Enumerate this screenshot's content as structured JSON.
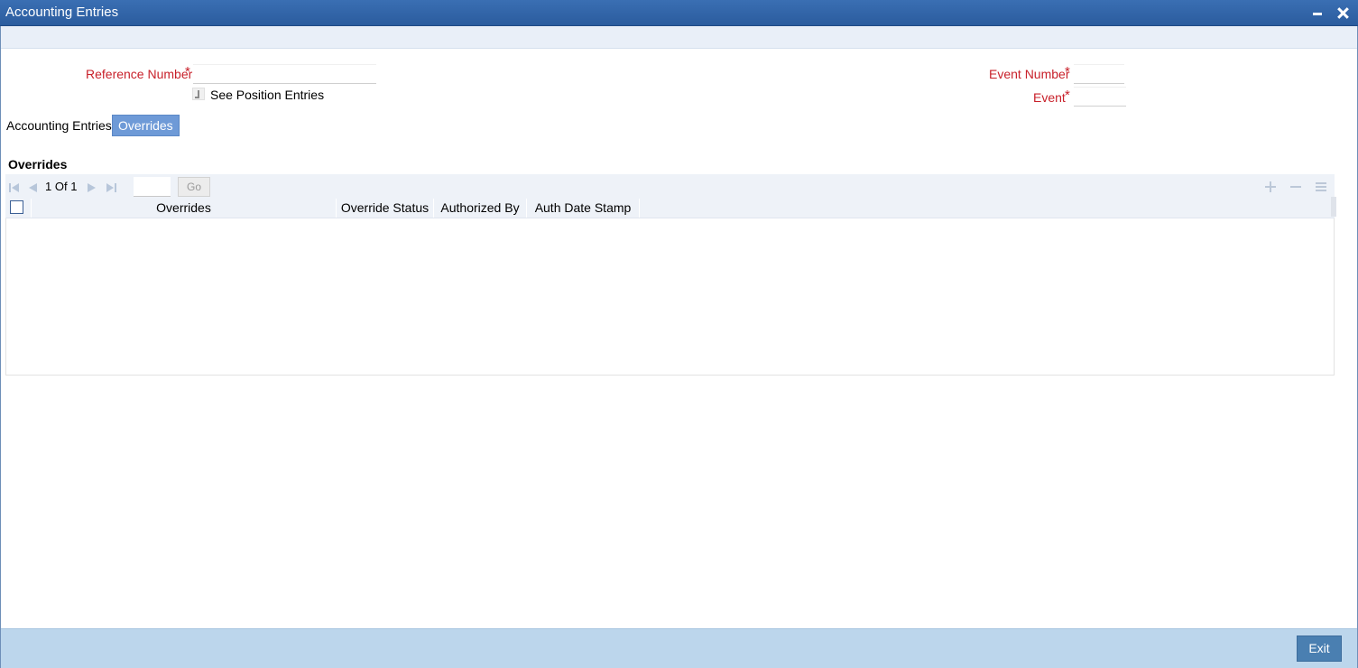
{
  "window": {
    "title": "Accounting Entries"
  },
  "form": {
    "reference_number_label": "Reference Number",
    "reference_number_value": "",
    "see_position_entries_label": "See Position Entries",
    "event_number_label": "Event Number",
    "event_number_value": "",
    "event_label": "Event",
    "event_value": "",
    "required_marker": "*"
  },
  "tabs": [
    {
      "label": "Accounting Entries",
      "active": false
    },
    {
      "label": "Overrides",
      "active": true
    }
  ],
  "overrides_section": {
    "title": "Overrides",
    "pager": {
      "current_page": "1",
      "of_label": "Of",
      "total_pages": "1",
      "go_label": "Go"
    },
    "columns": [
      "Overrides",
      "Override Status",
      "Authorized By",
      "Auth Date Stamp"
    ],
    "rows": []
  },
  "footer": {
    "exit_label": "Exit"
  },
  "colors": {
    "title_bar": "#2b5c9e",
    "required_label": "#c8202a",
    "active_tab": "#6e9ad7",
    "footer_bg": "#bcd6ec",
    "exit_button": "#4a7fb1"
  },
  "icons": [
    "minimize-icon",
    "close-icon",
    "first-page-icon",
    "previous-page-icon",
    "next-page-icon",
    "last-page-icon",
    "add-row-icon",
    "delete-row-icon",
    "single-view-icon"
  ]
}
